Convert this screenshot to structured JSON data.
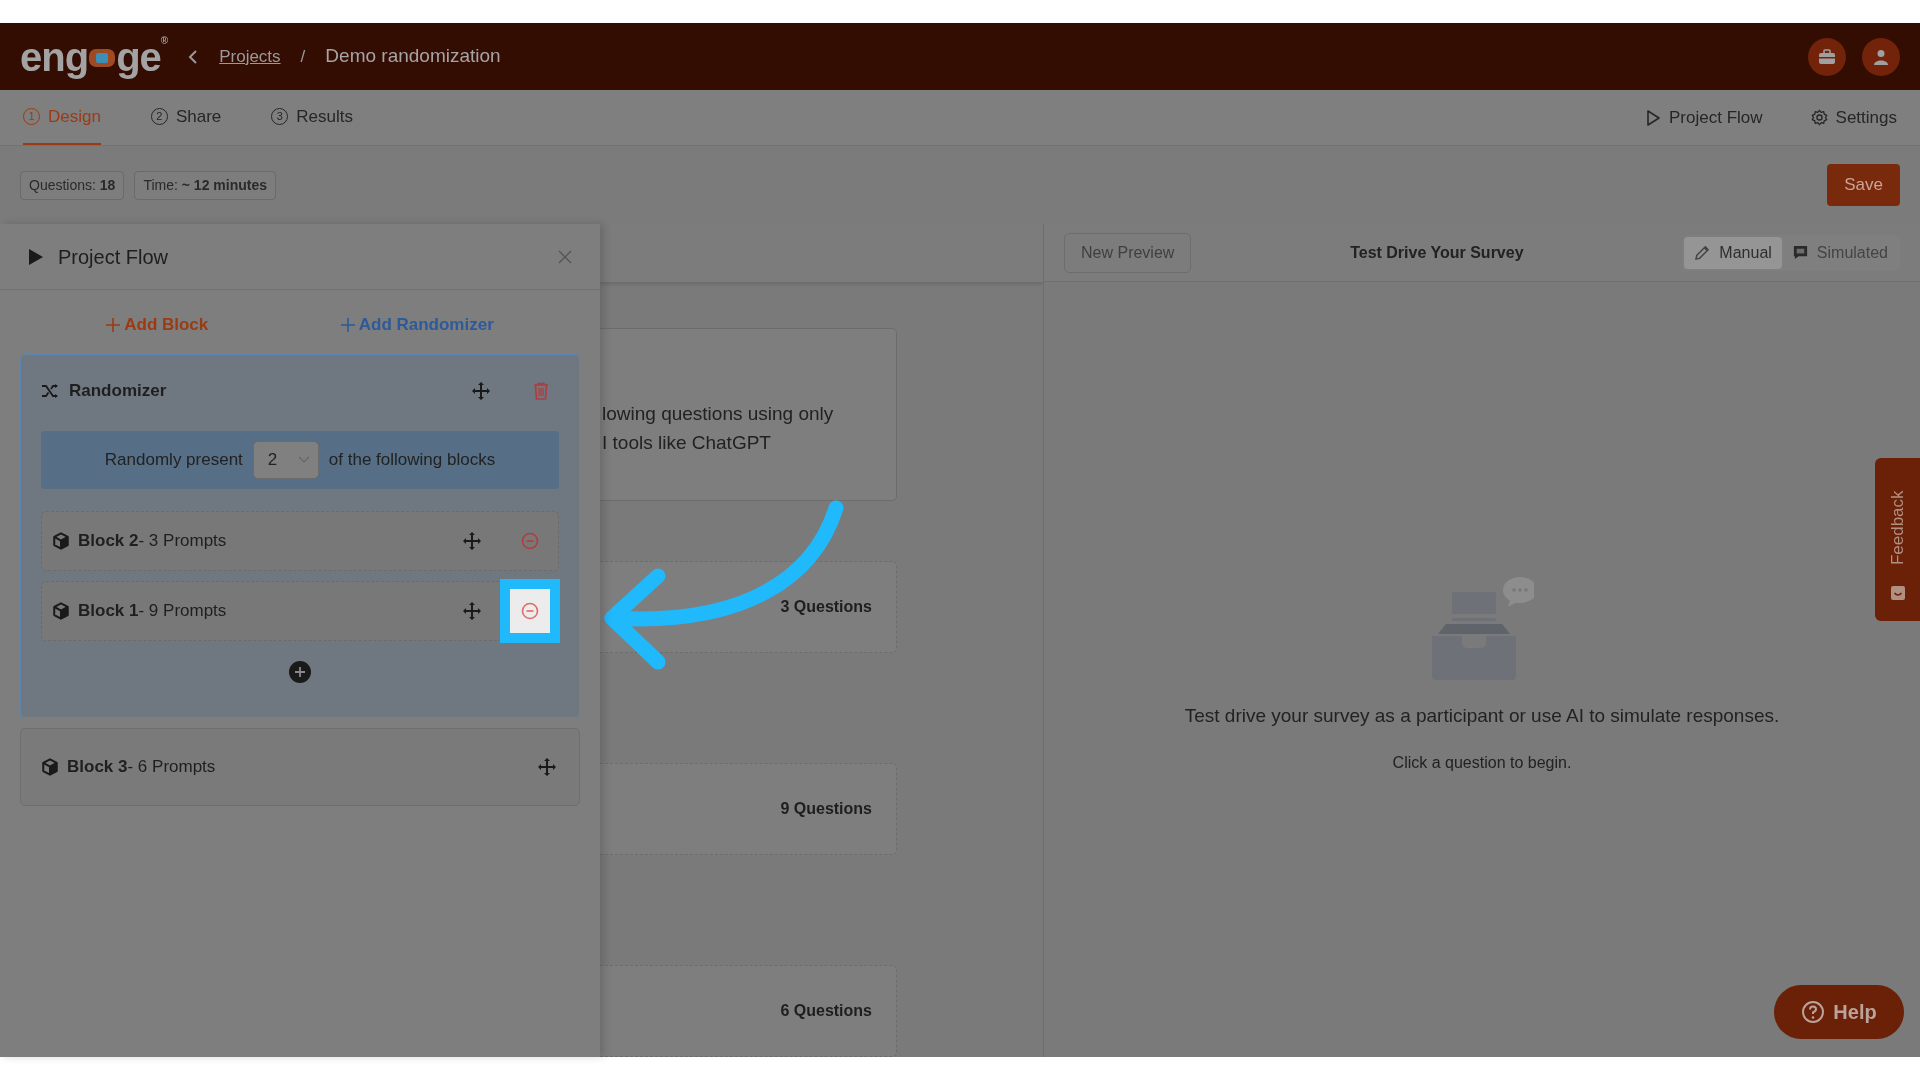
{
  "header": {
    "logo": {
      "text_start": "eng",
      "text_end": "ge",
      "mark": "®"
    },
    "breadcrumb": {
      "parent": "Projects",
      "separator": "/",
      "current": "Demo randomization"
    }
  },
  "tabs": [
    {
      "number": "1",
      "label": "Design",
      "selected": true
    },
    {
      "number": "2",
      "label": "Share",
      "selected": false
    },
    {
      "number": "3",
      "label": "Results",
      "selected": false
    }
  ],
  "tab_actions": [
    {
      "kind": "play",
      "label": "Project Flow"
    },
    {
      "kind": "gear",
      "label": "Settings"
    }
  ],
  "summary": [
    {
      "label": "Questions:",
      "value": "18"
    },
    {
      "label": "Time:",
      "value": "~ 12 minutes"
    }
  ],
  "save_button": "Save",
  "project_flow": {
    "title": "Project Flow",
    "add_block": "Add Block",
    "add_randomizer": "Add Randomizer",
    "randomizer": {
      "title": "Randomizer",
      "present_before": "Randomly present",
      "count": "2",
      "present_after": "of the following blocks",
      "blocks": [
        {
          "text": "**Block 2**- 3 Prompts",
          "highlighted": false
        },
        {
          "text": "**Block 1**- 9 Prompts",
          "highlighted": true
        }
      ]
    },
    "blocks": [
      {
        "text": "**Block 3**- 6 Prompts"
      }
    ]
  },
  "editor_cards": [
    {
      "kind": "text",
      "lines": [
        "lowing questions using only",
        "I tools like ChatGPT"
      ]
    },
    {
      "kind": "count",
      "text": "3 Questions"
    },
    {
      "kind": "count",
      "text": "9 Questions"
    },
    {
      "kind": "count",
      "text": "6 Questions"
    }
  ],
  "preview": {
    "new_preview": "New Preview",
    "title": "Test Drive Your Survey",
    "modes": [
      {
        "kind": "pencil",
        "label": "Manual",
        "selected": true
      },
      {
        "kind": "chat",
        "label": "Simulated",
        "selected": false
      }
    ],
    "message": "Test drive your survey as a participant or use AI to simulate responses.",
    "hint": "Click a question to begin."
  },
  "feedback_tab": "Feedback",
  "help_button": "Help"
}
